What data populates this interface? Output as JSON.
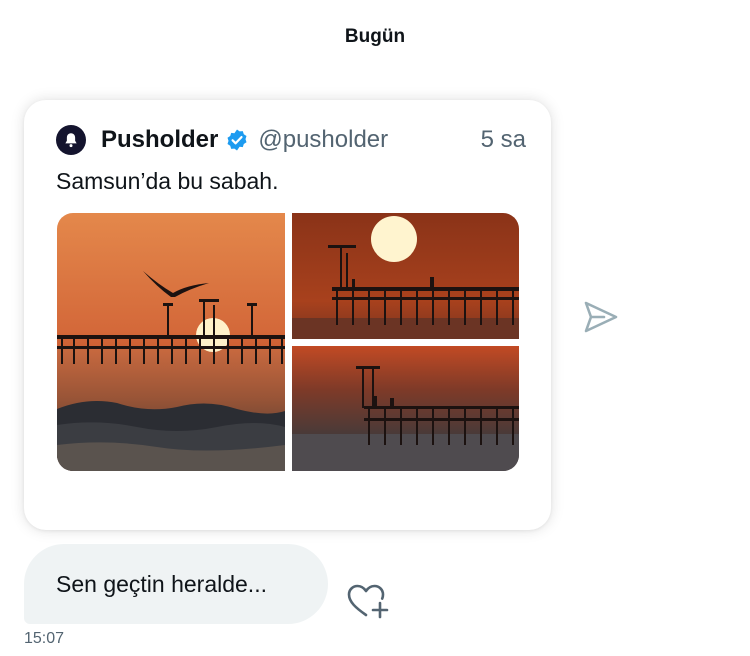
{
  "conversation": {
    "day_label": "Bugün"
  },
  "tweet": {
    "author_name": "Pusholder",
    "author_handle": "@pusholder",
    "time": "5 sa",
    "text": "Samsun’da bu sabah.",
    "verified": true,
    "avatar_icon": "bell-icon",
    "photos": [
      {
        "subject": "seagull-over-pier-at-sunrise"
      },
      {
        "subject": "pier-under-large-sun"
      },
      {
        "subject": "pier-silhouette-at-dawn"
      }
    ]
  },
  "message": {
    "text": "Sen geçtin heralde...",
    "time": "15:07"
  },
  "icons": {
    "share": "paper-plane-icon",
    "react": "heart-plus-icon"
  },
  "colors": {
    "accent_blue": "#1d9bf0",
    "text_primary": "#0f1419",
    "text_secondary": "#536471",
    "bubble_bg": "#eff3f4"
  }
}
